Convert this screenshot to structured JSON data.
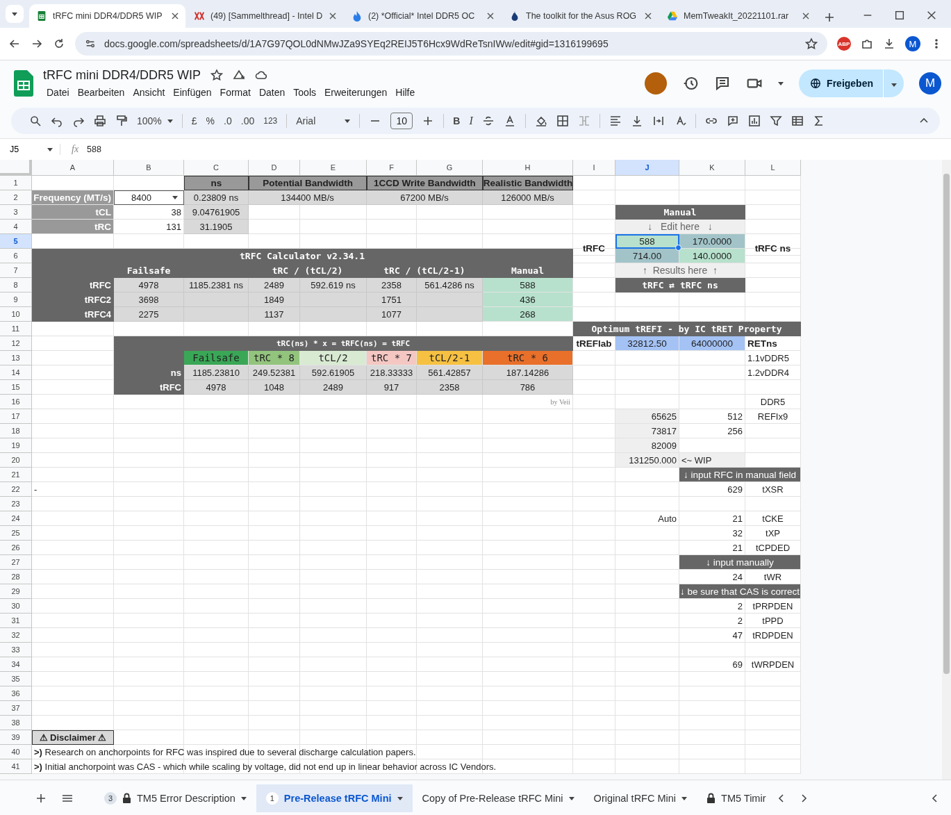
{
  "browser": {
    "tabs": [
      {
        "title": "tRFC mini DDR4/DDR5 WIP",
        "selected": true
      },
      {
        "title": "(49) [Sammelthread] - Intel D",
        "selected": false
      },
      {
        "title": "(2) *Official* Intel DDR5 OC",
        "selected": false
      },
      {
        "title": "The toolkit for the Asus ROG",
        "selected": false
      },
      {
        "title": "MemTweakIt_20221101.rar",
        "selected": false
      }
    ],
    "url": "docs.google.com/spreadsheets/d/1A7G97QOL0dNMwJZa9SYEq2REIJ5T6Hcx9WdReTsnIWw/edit#gid=1316199695",
    "extension_badge": "ABP",
    "profile": "M"
  },
  "document": {
    "title": "tRFC mini DDR4/DDR5 WIP",
    "menu": [
      "Datei",
      "Bearbeiten",
      "Ansicht",
      "Einfügen",
      "Format",
      "Daten",
      "Tools",
      "Erweiterungen",
      "Hilfe"
    ],
    "share_button": "Freigeben",
    "account": "M"
  },
  "toolbar": {
    "zoom": "100%",
    "currency": "£",
    "percent": "%",
    "decrease_decimal": ".0",
    "increase_decimal": ".00",
    "number_format": "123",
    "font": "Arial",
    "font_size": "10",
    "bold": "B",
    "italic": "I"
  },
  "formula_bar": {
    "name_box": "J5",
    "fx": "fx",
    "formula": "588"
  },
  "grid": {
    "columns": [
      {
        "label": "A",
        "selected": false
      },
      {
        "label": "B",
        "selected": false
      },
      {
        "label": "C",
        "selected": false
      },
      {
        "label": "D",
        "selected": false
      },
      {
        "label": "E",
        "selected": false
      },
      {
        "label": "F",
        "selected": false
      },
      {
        "label": "G",
        "selected": false
      },
      {
        "label": "H",
        "selected": false
      },
      {
        "label": "I",
        "selected": false
      },
      {
        "label": "J",
        "selected": true
      },
      {
        "label": "K",
        "selected": false
      },
      {
        "label": "L",
        "selected": false
      }
    ],
    "rows": [
      {
        "header": "1",
        "selected": false,
        "cells": [
          null,
          null,
          {
            "kind": "head",
            "text": "ns"
          },
          {
            "kind": "head",
            "text": "Potential Bandwidth"
          },
          {
            "kind": "merged"
          },
          {
            "kind": "head",
            "text": "1CCD Write Bandwidth"
          },
          {
            "kind": "merged"
          },
          {
            "kind": "head",
            "text": "Realistic Bandwidth"
          }
        ]
      },
      {
        "header": "2",
        "selected": false,
        "cells": [
          {
            "kind": "side",
            "text": "Frequency (MT/s)"
          },
          {
            "kind": "dropdown",
            "text": "8400"
          },
          {
            "kind": "value",
            "text": "0.23809 ns"
          },
          {
            "kind": "value",
            "text": "134400 MB/s"
          },
          {
            "kind": "merged"
          },
          {
            "kind": "value",
            "text": "67200 MB/s"
          },
          {
            "kind": "merged"
          },
          {
            "kind": "value",
            "text": "126000 MB/s"
          }
        ]
      },
      {
        "header": "3",
        "selected": false,
        "cells": [
          {
            "kind": "side",
            "text": "tCL"
          },
          {
            "kind": "number",
            "text": "38"
          },
          {
            "kind": "value",
            "text": "9.04761905"
          },
          null,
          null,
          null,
          null,
          null,
          null,
          {
            "kind": "title",
            "text": "Manual"
          },
          {
            "kind": "merged"
          }
        ]
      },
      {
        "header": "4",
        "selected": false,
        "cells": [
          {
            "kind": "side",
            "text": "tRC"
          },
          {
            "kind": "number",
            "text": "131"
          },
          {
            "kind": "value",
            "text": "31.1905"
          },
          null,
          null,
          null,
          null,
          null,
          null,
          {
            "kind": "hint",
            "text": "↓   Edit here   ↓"
          },
          {
            "kind": "merged"
          }
        ]
      },
      {
        "header": "5",
        "selected": true,
        "cells": [
          null,
          null,
          null,
          null,
          null,
          null,
          null,
          null,
          {
            "kind": "bold-mid",
            "text": "tRFC"
          },
          {
            "kind": "fill",
            "text": "588",
            "color": "#b7e1cd"
          },
          {
            "kind": "fill",
            "text": "170.0000",
            "color": "#a2c4c9"
          },
          {
            "kind": "bold-mid",
            "text": "tRFC ns"
          }
        ]
      },
      {
        "header": "6",
        "selected": false,
        "cells": [
          {
            "kind": "title",
            "text": "tRFC Calculator v2.34.1"
          },
          {
            "kind": "merged"
          },
          {
            "kind": "merged"
          },
          {
            "kind": "merged"
          },
          {
            "kind": "merged"
          },
          {
            "kind": "merged"
          },
          {
            "kind": "merged"
          },
          {
            "kind": "merged"
          },
          null,
          {
            "kind": "fill",
            "text": "714.00",
            "color": "#a2c4c9"
          },
          {
            "kind": "fill",
            "text": "140.0000",
            "color": "#b7e1cd"
          }
        ]
      },
      {
        "header": "7",
        "selected": false,
        "cells": [
          {
            "kind": "title"
          },
          {
            "kind": "title",
            "text": "Failsafe"
          },
          {
            "kind": "title"
          },
          {
            "kind": "title",
            "text": "tRC / (tCL/2)"
          },
          {
            "kind": "merged"
          },
          {
            "kind": "title",
            "text": "tRC / (tCL/2-1)"
          },
          {
            "kind": "merged"
          },
          {
            "kind": "title",
            "text": "Manual"
          },
          null,
          {
            "kind": "hint",
            "text": "↑  Results here  ↑"
          },
          {
            "kind": "merged"
          }
        ]
      },
      {
        "header": "8",
        "selected": false,
        "cells": [
          {
            "kind": "label",
            "text": "tRFC"
          },
          {
            "kind": "value",
            "text": "4978"
          },
          {
            "kind": "value",
            "text": "1185.2381 ns"
          },
          {
            "kind": "value",
            "text": "2489"
          },
          {
            "kind": "value",
            "text": "592.619 ns"
          },
          {
            "kind": "value",
            "text": "2358"
          },
          {
            "kind": "value",
            "text": "561.4286 ns"
          },
          {
            "kind": "fill",
            "text": "588",
            "color": "#b7e1cd"
          },
          null,
          {
            "kind": "title",
            "text": "tRFC ⇄ tRFC ns"
          },
          {
            "kind": "merged"
          }
        ]
      },
      {
        "header": "9",
        "selected": false,
        "cells": [
          {
            "kind": "label",
            "text": "tRFC2"
          },
          {
            "kind": "value",
            "text": "3698"
          },
          {
            "kind": "value"
          },
          {
            "kind": "value",
            "text": "1849"
          },
          {
            "kind": "value"
          },
          {
            "kind": "value",
            "text": "1751"
          },
          {
            "kind": "value"
          },
          {
            "kind": "fill",
            "text": "436",
            "color": "#b7e1cd"
          }
        ]
      },
      {
        "header": "10",
        "selected": false,
        "cells": [
          {
            "kind": "label",
            "text": "tRFC4"
          },
          {
            "kind": "value",
            "text": "2275"
          },
          {
            "kind": "value"
          },
          {
            "kind": "value",
            "text": "1137"
          },
          {
            "kind": "value"
          },
          {
            "kind": "value",
            "text": "1077"
          },
          {
            "kind": "value"
          },
          {
            "kind": "fill",
            "text": "268",
            "color": "#b7e1cd"
          }
        ]
      },
      {
        "header": "11",
        "selected": false,
        "cells": [
          null,
          null,
          null,
          null,
          null,
          null,
          null,
          null,
          {
            "kind": "title",
            "text": "Optimum tREFI - by IC tRET Property"
          },
          {
            "kind": "merged"
          },
          {
            "kind": "merged"
          },
          {
            "kind": "merged"
          }
        ]
      },
      {
        "header": "12",
        "selected": false,
        "cells": [
          null,
          {
            "kind": "subtitle",
            "text": "tRC(ns) * x = tRFC(ns) = tRFC"
          },
          {
            "kind": "merged"
          },
          {
            "kind": "merged"
          },
          {
            "kind": "merged"
          },
          {
            "kind": "merged"
          },
          {
            "kind": "merged"
          },
          {
            "kind": "merged"
          },
          {
            "kind": "bold",
            "text": "tREFlab"
          },
          {
            "kind": "fill",
            "text": "32812.50",
            "color": "#a4c2f4"
          },
          {
            "kind": "fill",
            "text": "64000000",
            "color": "#a4c2f4"
          },
          {
            "kind": "bold-left",
            "text": "RETns"
          }
        ]
      },
      {
        "header": "13",
        "selected": false,
        "cells": [
          null,
          {
            "kind": "title"
          },
          {
            "kind": "tag",
            "text": "Failsafe",
            "color": "#3aa757"
          },
          {
            "kind": "tag",
            "text": "tRC * 8",
            "color": "#93c47d"
          },
          {
            "kind": "tag",
            "text": "tCL/2",
            "color": "#d9ead3"
          },
          {
            "kind": "tag",
            "text": "tRC * 7",
            "color": "#f4c7c3"
          },
          {
            "kind": "tag",
            "text": "tCL/2-1",
            "color": "#f6c142"
          },
          {
            "kind": "tag",
            "text": "tRC * 6",
            "color": "#e8702a"
          },
          null,
          null,
          null,
          {
            "kind": "text",
            "text": "1.1vDDR5"
          }
        ]
      },
      {
        "header": "14",
        "selected": false,
        "cells": [
          null,
          {
            "kind": "label",
            "text": "ns"
          },
          {
            "kind": "value",
            "text": "1185.23810"
          },
          {
            "kind": "value",
            "text": "249.52381"
          },
          {
            "kind": "value",
            "text": "592.61905"
          },
          {
            "kind": "value",
            "text": "218.33333"
          },
          {
            "kind": "value",
            "text": "561.42857"
          },
          {
            "kind": "value",
            "text": "187.14286"
          },
          null,
          null,
          null,
          {
            "kind": "text",
            "text": "1.2vDDR4"
          }
        ]
      },
      {
        "header": "15",
        "selected": false,
        "cells": [
          null,
          {
            "kind": "label",
            "text": "tRFC"
          },
          {
            "kind": "value",
            "text": "4978"
          },
          {
            "kind": "value",
            "text": "1048"
          },
          {
            "kind": "value",
            "text": "2489"
          },
          {
            "kind": "value",
            "text": "917"
          },
          {
            "kind": "value",
            "text": "2358"
          },
          {
            "kind": "value",
            "text": "786"
          }
        ]
      },
      {
        "header": "16",
        "selected": false,
        "cells": [
          null,
          null,
          null,
          null,
          null,
          null,
          null,
          {
            "kind": "note",
            "text": "by Veii"
          },
          null,
          null,
          null,
          {
            "kind": "center",
            "text": "DDR5"
          }
        ]
      },
      {
        "header": "17",
        "selected": false,
        "cells": [
          null,
          null,
          null,
          null,
          null,
          null,
          null,
          null,
          null,
          {
            "kind": "grey",
            "text": "65625"
          },
          {
            "kind": "number",
            "text": "512"
          },
          {
            "kind": "center",
            "text": "REFIx9"
          }
        ]
      },
      {
        "header": "18",
        "selected": false,
        "cells": [
          null,
          null,
          null,
          null,
          null,
          null,
          null,
          null,
          null,
          {
            "kind": "grey",
            "text": "73817"
          },
          {
            "kind": "number",
            "text": "256"
          }
        ]
      },
      {
        "header": "19",
        "selected": false,
        "cells": [
          null,
          null,
          null,
          null,
          null,
          null,
          null,
          null,
          null,
          {
            "kind": "grey",
            "text": "82009"
          }
        ]
      },
      {
        "header": "20",
        "selected": false,
        "cells": [
          null,
          null,
          null,
          null,
          null,
          null,
          null,
          null,
          null,
          {
            "kind": "grey",
            "text": "131250.000"
          },
          {
            "kind": "grey-left",
            "text": "<~ WIP"
          }
        ]
      },
      {
        "header": "21",
        "selected": false,
        "cells": [
          null,
          null,
          null,
          null,
          null,
          null,
          null,
          null,
          null,
          null,
          {
            "kind": "banner",
            "text": "↓ input RFC in manual field"
          },
          {
            "kind": "merged"
          }
        ]
      },
      {
        "header": "22",
        "selected": false,
        "cells": [
          {
            "kind": "text",
            "text": "-"
          },
          null,
          null,
          null,
          null,
          null,
          null,
          null,
          null,
          null,
          {
            "kind": "number",
            "text": "629"
          },
          {
            "kind": "center",
            "text": "tXSR"
          }
        ]
      },
      {
        "header": "23",
        "selected": false
      },
      {
        "header": "24",
        "selected": false,
        "cells": [
          null,
          null,
          null,
          null,
          null,
          null,
          null,
          null,
          null,
          {
            "kind": "number",
            "text": "Auto"
          },
          {
            "kind": "number",
            "text": "21"
          },
          {
            "kind": "center",
            "text": "tCKE"
          }
        ]
      },
      {
        "header": "25",
        "selected": false,
        "cells": [
          null,
          null,
          null,
          null,
          null,
          null,
          null,
          null,
          null,
          null,
          {
            "kind": "number",
            "text": "32"
          },
          {
            "kind": "center",
            "text": "tXP"
          }
        ]
      },
      {
        "header": "26",
        "selected": false,
        "cells": [
          null,
          null,
          null,
          null,
          null,
          null,
          null,
          null,
          null,
          null,
          {
            "kind": "number",
            "text": "21"
          },
          {
            "kind": "center",
            "text": "tCPDED"
          }
        ]
      },
      {
        "header": "27",
        "selected": false,
        "cells": [
          null,
          null,
          null,
          null,
          null,
          null,
          null,
          null,
          null,
          null,
          {
            "kind": "banner",
            "text": "↓ input manually"
          },
          {
            "kind": "merged"
          }
        ]
      },
      {
        "header": "28",
        "selected": false,
        "cells": [
          null,
          null,
          null,
          null,
          null,
          null,
          null,
          null,
          null,
          null,
          {
            "kind": "number",
            "text": "24"
          },
          {
            "kind": "center",
            "text": "tWR"
          }
        ]
      },
      {
        "header": "29",
        "selected": false,
        "cells": [
          null,
          null,
          null,
          null,
          null,
          null,
          null,
          null,
          null,
          null,
          {
            "kind": "banner",
            "text": "↓ be sure that CAS is correct"
          },
          {
            "kind": "merged"
          }
        ]
      },
      {
        "header": "30",
        "selected": false,
        "cells": [
          null,
          null,
          null,
          null,
          null,
          null,
          null,
          null,
          null,
          null,
          {
            "kind": "number",
            "text": "2"
          },
          {
            "kind": "center",
            "text": "tPRPDEN"
          }
        ]
      },
      {
        "header": "31",
        "selected": false,
        "cells": [
          null,
          null,
          null,
          null,
          null,
          null,
          null,
          null,
          null,
          null,
          {
            "kind": "number",
            "text": "2"
          },
          {
            "kind": "center",
            "text": "tPPD"
          }
        ]
      },
      {
        "header": "32",
        "selected": false,
        "cells": [
          null,
          null,
          null,
          null,
          null,
          null,
          null,
          null,
          null,
          null,
          {
            "kind": "number",
            "text": "47"
          },
          {
            "kind": "center",
            "text": "tRDPDEN"
          }
        ]
      },
      {
        "header": "33",
        "selected": false
      },
      {
        "header": "34",
        "selected": false,
        "cells": [
          null,
          null,
          null,
          null,
          null,
          null,
          null,
          null,
          null,
          null,
          {
            "kind": "number",
            "text": "69"
          },
          {
            "kind": "center",
            "text": "tWRPDEN"
          }
        ]
      },
      {
        "header": "35",
        "selected": false
      },
      {
        "header": "36",
        "selected": false
      },
      {
        "header": "37",
        "selected": false
      },
      {
        "header": "38",
        "selected": false
      },
      {
        "header": "39",
        "selected": false,
        "cells": [
          {
            "kind": "disclaimer",
            "text": "⚠ Disclaimer ⚠"
          }
        ]
      },
      {
        "header": "40",
        "selected": false,
        "cells": [
          {
            "kind": "text",
            "text": "**>)** Research on anchorpoints for RFC was inspired due to several discharge calculation papers."
          },
          {
            "kind": "merged"
          },
          {
            "kind": "merged"
          },
          {
            "kind": "merged"
          },
          {
            "kind": "merged"
          },
          {
            "kind": "merged"
          },
          {
            "kind": "merged"
          },
          {
            "kind": "merged"
          },
          {
            "kind": "merged"
          },
          {
            "kind": "merged"
          },
          {
            "kind": "merged"
          },
          {
            "kind": "merged"
          }
        ]
      },
      {
        "header": "41",
        "selected": false,
        "cells": [
          {
            "kind": "text",
            "text": "**>)** Initial anchorpoint was CAS - which while scaling by voltage, did not end up in linear behavior across IC Vendors."
          },
          {
            "kind": "merged"
          },
          {
            "kind": "merged"
          },
          {
            "kind": "merged"
          },
          {
            "kind": "merged"
          },
          {
            "kind": "merged"
          },
          {
            "kind": "merged"
          },
          {
            "kind": "merged"
          },
          {
            "kind": "merged"
          },
          {
            "kind": "merged"
          },
          {
            "kind": "merged"
          },
          {
            "kind": "merged"
          }
        ]
      }
    ]
  },
  "sheet_tabs": [
    {
      "count": "3",
      "locked": true,
      "label": "TM5 Error Description",
      "selected": false
    },
    {
      "count": "1",
      "locked": false,
      "label": "Pre-Release tRFC Mini",
      "selected": true
    },
    {
      "locked": false,
      "label": "Copy of Pre-Release tRFC Mini",
      "selected": false
    },
    {
      "locked": false,
      "label": "Original tRFC Mini",
      "selected": false
    },
    {
      "locked": true,
      "label": "TM5 Timir",
      "selected": false
    }
  ]
}
